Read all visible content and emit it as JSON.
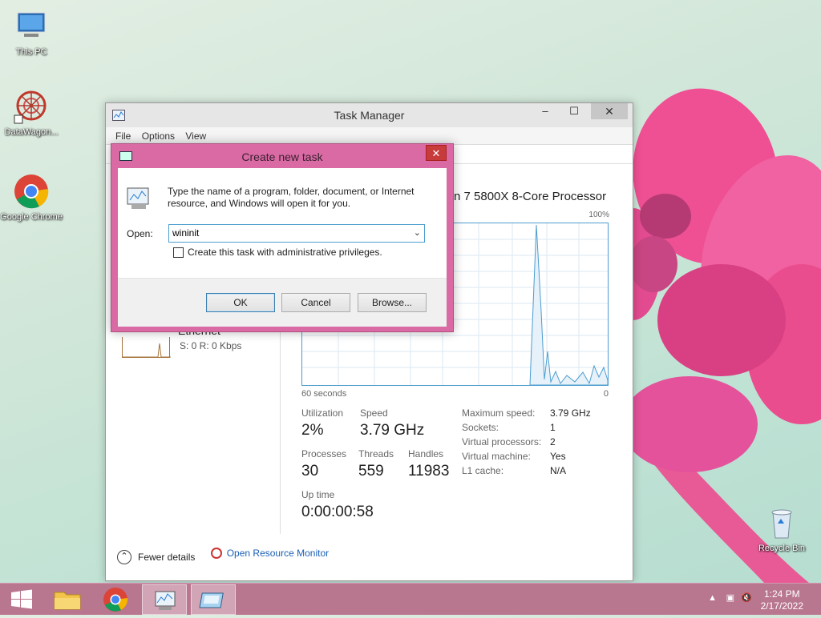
{
  "desktop": {
    "icons": [
      {
        "label": "This PC",
        "icon": "this-pc-icon"
      },
      {
        "label": "DataWagon...",
        "icon": "datawagon-icon"
      },
      {
        "label": "Google Chrome",
        "icon": "chrome-icon"
      },
      {
        "label": "Recycle Bin",
        "icon": "recycle-bin-icon"
      }
    ]
  },
  "task_manager": {
    "title": "Task Manager",
    "menu": [
      "File",
      "Options",
      "View"
    ],
    "min_btn": "‒",
    "max_btn": "☐",
    "close_btn": "✕",
    "ethernet_title": "Ethernet",
    "ethernet_sub": "S: 0 R: 0 Kbps",
    "cpu_name": "n 7 5800X 8-Core Processor",
    "graph_max": "100%",
    "graph_left": "60 seconds",
    "graph_right": "0",
    "utilization_label": "Utilization",
    "utilization_value": "2%",
    "speed_label": "Speed",
    "speed_value": "3.79 GHz",
    "processes_label": "Processes",
    "processes_value": "30",
    "threads_label": "Threads",
    "threads_value": "559",
    "handles_label": "Handles",
    "handles_value": "11983",
    "uptime_label": "Up time",
    "uptime_value": "0:00:00:58",
    "details": [
      {
        "label": "Maximum speed:",
        "value": "3.79 GHz"
      },
      {
        "label": "Sockets:",
        "value": "1"
      },
      {
        "label": "Virtual processors:",
        "value": "2"
      },
      {
        "label": "Virtual machine:",
        "value": "Yes"
      },
      {
        "label": "L1 cache:",
        "value": "N/A"
      }
    ],
    "fewer_details": "Fewer details",
    "open_resmon": "Open Resource Monitor",
    "colors": {
      "graph_line": "#4d9dcf",
      "link": "#1a5fb4"
    }
  },
  "run_dialog": {
    "title": "Create new task",
    "close_btn": "✕",
    "description": "Type the name of a program, folder, document, or Internet resource, and Windows will open it for you.",
    "open_label": "Open:",
    "open_value": "wininit",
    "admin_checkbox_label": "Create this task with administrative privileges.",
    "admin_checked": false,
    "ok_label": "OK",
    "cancel_label": "Cancel",
    "browse_label": "Browse...",
    "colors": {
      "frame": "#d96aa4"
    }
  },
  "taskbar": {
    "items": [
      "start-icon",
      "file-explorer-icon",
      "chrome-icon",
      "task-manager-icon",
      "run-dialog-icon"
    ],
    "time": "1:24 PM",
    "date": "2/17/2022",
    "colors": {
      "bar": "#b9768f"
    }
  }
}
